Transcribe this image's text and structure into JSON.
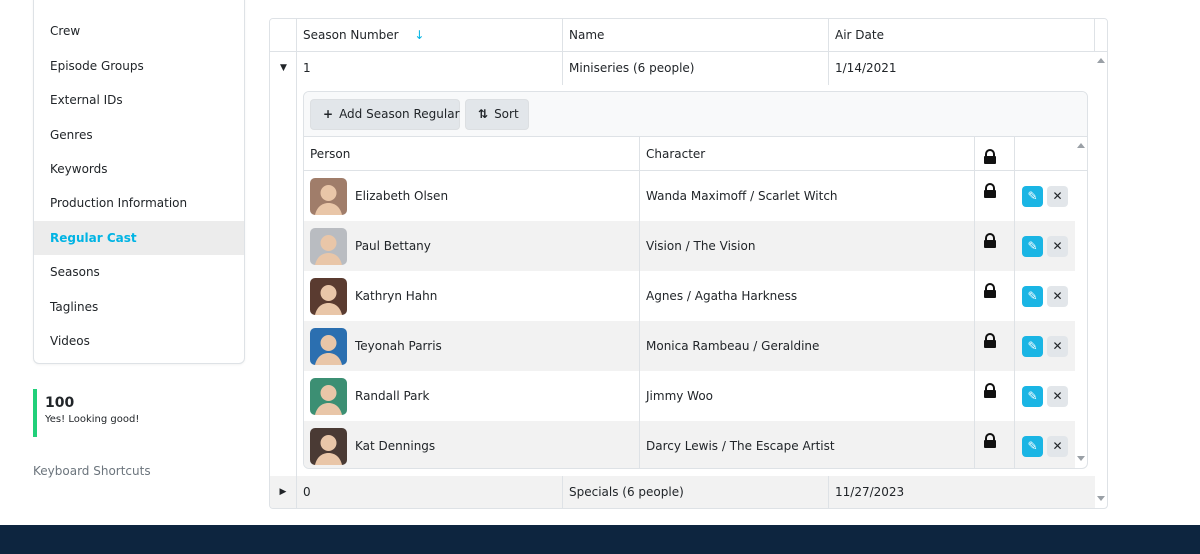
{
  "sidebar": {
    "items": [
      {
        "label": "Crew"
      },
      {
        "label": "Episode Groups"
      },
      {
        "label": "External IDs"
      },
      {
        "label": "Genres"
      },
      {
        "label": "Keywords"
      },
      {
        "label": "Production Information"
      },
      {
        "label": "Regular Cast",
        "active": true
      },
      {
        "label": "Seasons"
      },
      {
        "label": "Taglines"
      },
      {
        "label": "Videos"
      }
    ]
  },
  "score": {
    "value": "100",
    "message": "Yes! Looking good!"
  },
  "keyboard_shortcuts": "Keyboard Shortcuts",
  "seasons_table": {
    "columns": [
      "Season Number",
      "Name",
      "Air Date"
    ],
    "sort_icon": "↓",
    "rows": [
      {
        "number": "1",
        "name": "Miniseries (6 people)",
        "air_date": "1/14/2021",
        "expanded": true
      },
      {
        "number": "0",
        "name": "Specials (6 people)",
        "air_date": "11/27/2023",
        "expanded": false
      }
    ]
  },
  "cast_panel": {
    "add_label": "Add Season Regular",
    "add_icon": "+",
    "sort_label": "Sort",
    "sort_icon": "⇅",
    "columns": [
      "Person",
      "Character"
    ],
    "rows": [
      {
        "person": "Elizabeth Olsen",
        "character": "Wanda Maximoff / Scarlet Witch",
        "avatar_color": "#a07d6a"
      },
      {
        "person": "Paul Bettany",
        "character": "Vision / The Vision",
        "avatar_color": "#b9bcc1"
      },
      {
        "person": "Kathryn Hahn",
        "character": "Agnes / Agatha Harkness",
        "avatar_color": "#5a3b30"
      },
      {
        "person": "Teyonah Parris",
        "character": "Monica Rambeau / Geraldine",
        "avatar_color": "#2b6fb0"
      },
      {
        "person": "Randall Park",
        "character": "Jimmy Woo",
        "avatar_color": "#3c8f73"
      },
      {
        "person": "Kat Dennings",
        "character": "Darcy Lewis / The Escape Artist",
        "avatar_color": "#4a3a34"
      }
    ]
  },
  "colors": {
    "accent": "#01b4e4",
    "success": "#21d07a",
    "footer": "#0d253f"
  }
}
